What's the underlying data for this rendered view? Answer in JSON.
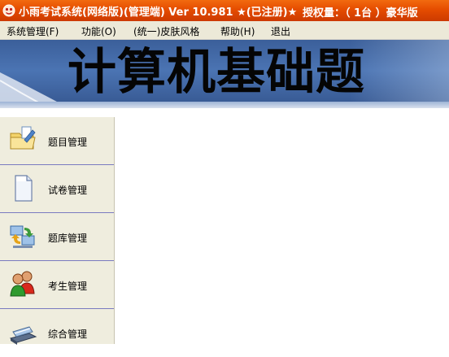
{
  "window": {
    "title": "小雨考试系统(网络版)(管理端) Ver 10.981 ★(已注册)★",
    "license": "授权量：（ 1台 ）豪华版",
    "icon": "app-icon"
  },
  "menu": {
    "items": [
      {
        "label": "系统管理(F)"
      },
      {
        "label": "功能(O)"
      },
      {
        "label": "(统一)皮肤风格"
      },
      {
        "label": "帮助(H)"
      },
      {
        "label": "退出"
      }
    ]
  },
  "banner": {
    "title": "计算机基础题"
  },
  "sidebar": {
    "items": [
      {
        "label": "题目管理",
        "icon": "folder-edit-icon"
      },
      {
        "label": "试卷管理",
        "icon": "document-icon"
      },
      {
        "label": "题库管理",
        "icon": "database-sync-icon"
      },
      {
        "label": "考生管理",
        "icon": "users-icon"
      },
      {
        "label": "综合管理",
        "icon": "scanner-icon"
      }
    ]
  },
  "colors": {
    "titlebar": "#e54c00",
    "menubar": "#ece9d8",
    "banner": "#4b74b3",
    "sidebar": "#efedde",
    "divider": "#7a7ac0"
  }
}
